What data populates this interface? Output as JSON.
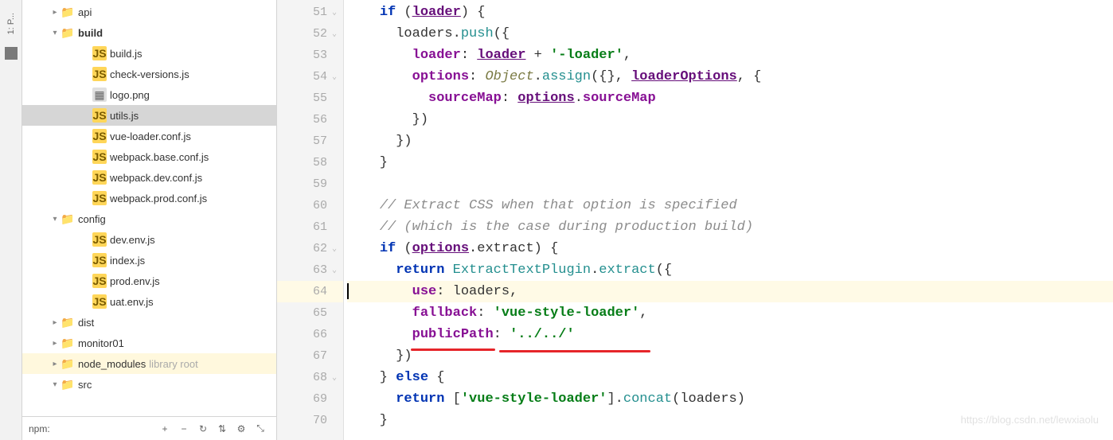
{
  "leftTab": "1: P...",
  "tree": {
    "top_item": "api",
    "build": {
      "name": "build",
      "files": [
        "build.js",
        "check-versions.js",
        "logo.png",
        "utils.js",
        "vue-loader.conf.js",
        "webpack.base.conf.js",
        "webpack.dev.conf.js",
        "webpack.prod.conf.js"
      ]
    },
    "config": {
      "name": "config",
      "files": [
        "dev.env.js",
        "index.js",
        "prod.env.js",
        "uat.env.js"
      ]
    },
    "dist": "dist",
    "monitor01": "monitor01",
    "node_modules": "node_modules",
    "node_modules_annot": "library root",
    "src": "src"
  },
  "npm_bar": {
    "label": "npm:"
  },
  "gutter": {
    "start": 51,
    "end": 70,
    "current": 64
  },
  "code": {
    "l51": {
      "kw": "if",
      "v": "loader"
    },
    "l52": {
      "v": "loaders",
      "m": "push"
    },
    "l53": {
      "p": "loader",
      "v": "loader",
      "s": "'-loader'"
    },
    "l54": {
      "p": "options",
      "o": "Object",
      "m": "assign",
      "v": "loaderOptions"
    },
    "l55": {
      "p": "sourceMap",
      "v": "options",
      "p2": "sourceMap"
    },
    "l60": "// Extract CSS when that option is specified",
    "l61": "// (which is the case during production build)",
    "l62": {
      "kw": "if",
      "v": "options",
      "p": "extract"
    },
    "l63": {
      "kw": "return",
      "c": "ExtractTextPlugin",
      "m": "extract"
    },
    "l64": {
      "p": "use",
      "v": "loaders"
    },
    "l65": {
      "p": "fallback",
      "s": "'vue-style-loader'"
    },
    "l66": {
      "p": "publicPath",
      "s": "'../../'"
    },
    "l68": {
      "kw": "else"
    },
    "l69": {
      "kw": "return",
      "s": "'vue-style-loader'",
      "m": "concat",
      "v": "loaders"
    }
  },
  "watermark": "https://blog.csdn.net/lewxiaolu",
  "chart_data": null
}
